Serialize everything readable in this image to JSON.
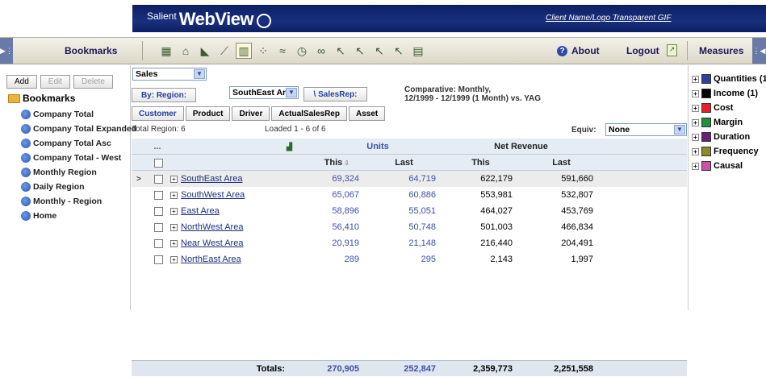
{
  "header": {
    "brand_small": "Salient",
    "brand_big": "WebView",
    "client": "Client Name/Logo Transparent GIF"
  },
  "toolbar": {
    "bookmarks_label": "Bookmarks",
    "about_label": "About",
    "logout_label": "Logout",
    "measures_label": "Measures",
    "icons": [
      {
        "name": "table-view-icon",
        "glyph": "▦"
      },
      {
        "name": "home-icon",
        "glyph": "⌂"
      },
      {
        "name": "area-chart-icon",
        "glyph": "◣"
      },
      {
        "name": "line-chart-icon",
        "glyph": "⟋"
      },
      {
        "name": "bar-chart-icon",
        "glyph": "▥",
        "selected": true
      },
      {
        "name": "scatter-chart-icon",
        "glyph": "⁘"
      },
      {
        "name": "trend-chart-icon",
        "glyph": "≈"
      },
      {
        "name": "clock-icon",
        "glyph": "◷"
      },
      {
        "name": "link-icon",
        "glyph": "∞"
      },
      {
        "name": "pointer-icon",
        "glyph": "↖"
      },
      {
        "name": "pointer-add-icon",
        "glyph": "↖"
      },
      {
        "name": "pointer-remove-icon",
        "glyph": "↖"
      },
      {
        "name": "pointer-star-icon",
        "glyph": "↖"
      },
      {
        "name": "export-icon",
        "glyph": "▤"
      }
    ]
  },
  "bookmarks": {
    "add_label": "Add",
    "edit_label": "Edit",
    "delete_label": "Delete",
    "root_label": "Bookmarks",
    "items": [
      "Company Total",
      "Company Total Expanded",
      "Company Total Asc",
      "Company Total - West",
      "Monthly Region",
      "Daily Region",
      "Monthly - Region",
      "Home"
    ]
  },
  "controls": {
    "measure_select": "Sales",
    "by_region_label": "By: Region:",
    "region_select": "SouthEast Area",
    "salesrep_label": "\\ SalesRep:",
    "comparative_line1": "Comparative: Monthly,",
    "comparative_line2": "12/1999 - 12/1999 (1 Month) vs. YAG",
    "tabs": [
      "Customer",
      "Product",
      "Driver",
      "ActualSalesRep",
      "Asset"
    ],
    "total_region": "Total Region: 6",
    "loaded": "Loaded 1 - 6 of 6",
    "equiv_label": "Equiv:",
    "equiv_select": "None"
  },
  "grid": {
    "ellipsis": "...",
    "units_header": "Units",
    "revenue_header": "Net Revenue",
    "this_label": "This",
    "last_label": "Last",
    "rows": [
      {
        "name": "SouthEast Area",
        "units_this": "69,324",
        "units_last": "64,719",
        "rev_this": "622,179",
        "rev_last": "591,660"
      },
      {
        "name": "SouthWest Area",
        "units_this": "65,067",
        "units_last": "60,886",
        "rev_this": "553,981",
        "rev_last": "532,807"
      },
      {
        "name": "East Area",
        "units_this": "58,896",
        "units_last": "55,051",
        "rev_this": "464,027",
        "rev_last": "453,769"
      },
      {
        "name": "NorthWest Area",
        "units_this": "56,410",
        "units_last": "50,748",
        "rev_this": "501,003",
        "rev_last": "466,834"
      },
      {
        "name": "Near West Area",
        "units_this": "20,919",
        "units_last": "21,148",
        "rev_this": "216,440",
        "rev_last": "204,491"
      },
      {
        "name": "NorthEast Area",
        "units_this": "289",
        "units_last": "295",
        "rev_this": "2,143",
        "rev_last": "1,997"
      }
    ],
    "totals_label": "Totals:",
    "totals": {
      "units_this": "270,905",
      "units_last": "252,847",
      "rev_this": "2,359,773",
      "rev_last": "2,251,558"
    }
  },
  "measures": [
    {
      "label": "Quantities (1",
      "color": "#2e3f9e"
    },
    {
      "label": "Income (1)",
      "color": "#000000"
    },
    {
      "label": "Cost",
      "color": "#e8202a"
    },
    {
      "label": "Margin",
      "color": "#1f8f3a"
    },
    {
      "label": "Duration",
      "color": "#6a1f7a"
    },
    {
      "label": "Frequency",
      "color": "#8c8a2a"
    },
    {
      "label": "Causal",
      "color": "#d24fa6"
    }
  ]
}
